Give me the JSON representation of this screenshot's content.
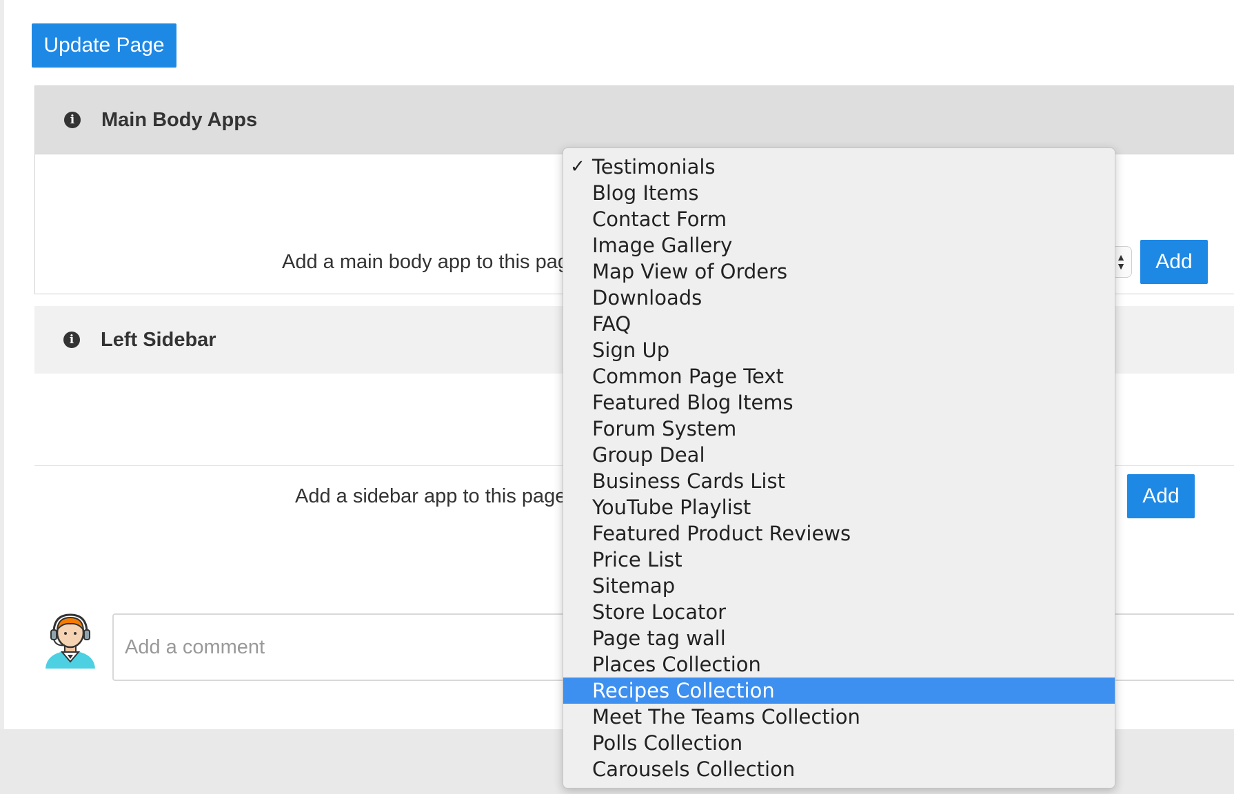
{
  "toolbar": {
    "update_label": "Update Page"
  },
  "main_body": {
    "title": "Main Body Apps",
    "add_label": "Add a main body app to this page",
    "add_button": "Add"
  },
  "left_sidebar": {
    "title": "Left Sidebar",
    "add_label": "Add a sidebar app to this page:",
    "add_button": "Add"
  },
  "comment": {
    "placeholder": "Add a comment"
  },
  "dropdown": {
    "checked_index": 0,
    "highlighted_index": 20,
    "options": [
      "Testimonials",
      "Blog Items",
      "Contact Form",
      "Image Gallery",
      "Map View of Orders",
      "Downloads",
      "FAQ",
      "Sign Up",
      "Common Page Text",
      "Featured Blog Items",
      "Forum System",
      "Group Deal",
      "Business Cards List",
      "YouTube Playlist",
      "Featured Product Reviews",
      "Price List",
      "Sitemap",
      "Store Locator",
      "Page tag wall",
      "Places Collection",
      "Recipes Collection",
      "Meet The Teams Collection",
      "Polls Collection",
      "Carousels Collection"
    ]
  },
  "colors": {
    "primary": "#1e88e5",
    "highlight": "#3d8ff0",
    "panel_header": "#dedede"
  }
}
